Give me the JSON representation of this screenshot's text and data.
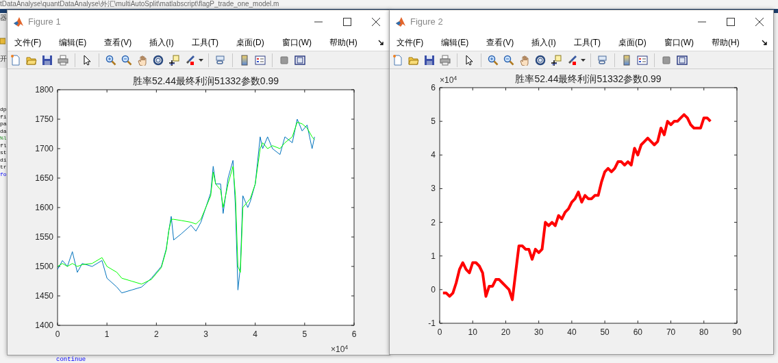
{
  "editor": {
    "path": "tDataAnalyse\\quantDataAnalyse\\外汇\\multiAutoSplit\\matlabscript\\flagP_trade_one_model.m",
    "side_labels": [
      "器",
      "开"
    ],
    "code_fragments": [
      {
        "text": "dp",
        "kind": "code"
      },
      {
        "text": "fi",
        "kind": "code"
      },
      {
        "text": "pa",
        "kind": "code"
      },
      {
        "text": "da",
        "kind": "code"
      },
      {
        "text": "%l",
        "kind": "comment"
      },
      {
        "text": "fl",
        "kind": "code"
      },
      {
        "text": "st",
        "kind": "code"
      },
      {
        "text": "di",
        "kind": "code"
      },
      {
        "text": "tr",
        "kind": "code"
      },
      {
        "text": "fo",
        "kind": "keyword"
      }
    ],
    "bottom_code": "continue"
  },
  "figures": [
    {
      "title": "Figure 1",
      "menu": [
        "文件(F)",
        "编辑(E)",
        "查看(V)",
        "插入(I)",
        "工具(T)",
        "桌面(D)",
        "窗口(W)",
        "帮助(H)"
      ],
      "x_exponent": "×10$^{4}$",
      "chart_data": {
        "type": "line",
        "title": "胜率52.44最终利润51332参数0.99",
        "x": [
          0,
          0.1,
          0.2,
          0.3,
          0.4,
          0.5,
          0.7,
          0.9,
          1.0,
          1.2,
          1.3,
          1.5,
          1.7,
          1.9,
          2.1,
          2.2,
          2.25,
          2.3,
          2.35,
          2.5,
          2.7,
          2.8,
          2.9,
          3.0,
          3.1,
          3.15,
          3.2,
          3.3,
          3.35,
          3.45,
          3.55,
          3.6,
          3.65,
          3.7,
          3.75,
          3.85,
          3.9,
          4.0,
          4.1,
          4.15,
          4.25,
          4.35,
          4.5,
          4.6,
          4.75,
          4.85,
          4.95,
          5.05,
          5.15,
          5.2
        ],
        "series": [
          {
            "color": "#0072bd",
            "values": [
              1495,
              1510,
              1500,
              1525,
              1490,
              1505,
              1500,
              1510,
              1480,
              1465,
              1455,
              1460,
              1465,
              1480,
              1500,
              1530,
              1560,
              1585,
              1545,
              1555,
              1570,
              1560,
              1575,
              1600,
              1625,
              1670,
              1640,
              1640,
              1590,
              1650,
              1680,
              1600,
              1460,
              1500,
              1620,
              1600,
              1610,
              1640,
              1720,
              1700,
              1720,
              1700,
              1690,
              1720,
              1710,
              1750,
              1730,
              1740,
              1700,
              1720
            ]
          },
          {
            "color": "#00ff00",
            "values": [
              1500,
              1505,
              1500,
              1505,
              1500,
              1503,
              1505,
              1515,
              1500,
              1490,
              1480,
              1475,
              1470,
              1478,
              1498,
              1528,
              1560,
              1580,
              1580,
              1578,
              1575,
              1572,
              1580,
              1600,
              1620,
              1660,
              1640,
              1630,
              1600,
              1640,
              1670,
              1620,
              1500,
              1490,
              1600,
              1610,
              1615,
              1640,
              1700,
              1710,
              1700,
              1705,
              1700,
              1710,
              1720,
              1745,
              1742,
              1735,
              1720,
              1715
            ]
          }
        ],
        "xlim": [
          0,
          6
        ],
        "ylim": [
          1400,
          1800
        ],
        "xticks": [
          0,
          1,
          2,
          3,
          4,
          5,
          6
        ],
        "yticks": [
          1400,
          1450,
          1500,
          1550,
          1600,
          1650,
          1700,
          1750,
          1800
        ]
      }
    },
    {
      "title": "Figure 2",
      "menu": [
        "文件(F)",
        "编辑(E)",
        "查看(V)",
        "插入(I)",
        "工具(T)",
        "桌面(D)",
        "窗口(W)",
        "帮助(H)"
      ],
      "y_exponent": "×10$^{4}$",
      "chart_data": {
        "type": "line",
        "title": "胜率52.44最终利润51332参数0.99",
        "x": [
          1,
          2,
          3,
          4,
          5,
          6,
          7,
          8,
          9,
          10,
          11,
          12,
          13,
          14,
          15,
          16,
          17,
          18,
          19,
          20,
          21,
          22,
          23,
          24,
          25,
          26,
          27,
          28,
          29,
          30,
          31,
          32,
          33,
          34,
          35,
          36,
          37,
          38,
          39,
          40,
          41,
          42,
          43,
          44,
          45,
          46,
          47,
          48,
          49,
          50,
          51,
          52,
          53,
          54,
          55,
          56,
          57,
          58,
          59,
          60,
          61,
          62,
          63,
          64,
          65,
          66,
          67,
          68,
          69,
          70,
          71,
          72,
          73,
          74,
          75,
          76,
          77,
          78,
          79,
          80,
          81,
          82
        ],
        "series": [
          {
            "color": "#ff0000",
            "values": [
              -0.1,
              -0.1,
              -0.2,
              -0.1,
              0.2,
              0.6,
              0.8,
              0.6,
              0.5,
              0.8,
              0.8,
              0.7,
              0.5,
              -0.2,
              0.1,
              0.1,
              0.3,
              0.3,
              0.2,
              0.1,
              0,
              -0.3,
              0.5,
              1.3,
              1.3,
              1.2,
              1.2,
              0.9,
              1.2,
              1.1,
              1.2,
              2.0,
              1.9,
              2.0,
              1.9,
              2.2,
              2.1,
              2.3,
              2.4,
              2.6,
              2.7,
              2.9,
              2.6,
              2.8,
              2.7,
              2.7,
              2.8,
              2.8,
              3.2,
              3.5,
              3.6,
              3.5,
              3.6,
              3.8,
              3.8,
              3.7,
              3.8,
              3.7,
              4.2,
              4.0,
              4.3,
              4.4,
              4.5,
              4.4,
              4.3,
              4.4,
              4.8,
              4.6,
              5.0,
              4.9,
              5.0,
              5.0,
              5.1,
              5.2,
              5.1,
              4.9,
              4.8,
              4.8,
              4.8,
              5.1,
              5.1,
              5.0
            ]
          }
        ],
        "xlim": [
          0,
          90
        ],
        "ylim": [
          -1,
          6
        ],
        "xticks": [
          0,
          10,
          20,
          30,
          40,
          50,
          60,
          70,
          80,
          90
        ],
        "yticks": [
          -1,
          0,
          1,
          2,
          3,
          4,
          5,
          6
        ]
      }
    }
  ]
}
